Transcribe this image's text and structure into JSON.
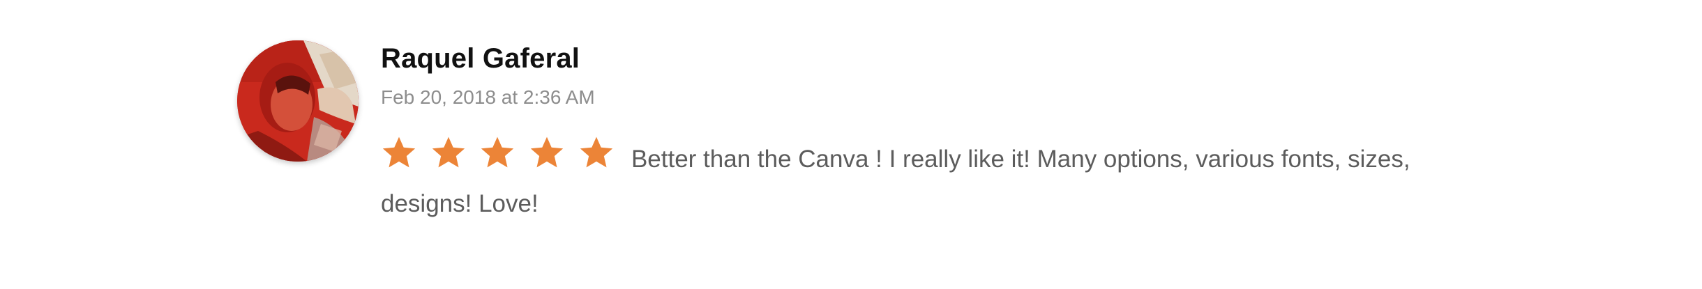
{
  "review": {
    "author": "Raquel Gaferal",
    "date": "Feb 20, 2018 at 2:36 AM",
    "rating": 5,
    "rating_max": 5,
    "text": "Better than the Canva ! I really like it! Many options, various fonts, sizes, designs! Love!",
    "star_icon": "star-icon",
    "star_color": "#ec8437"
  }
}
